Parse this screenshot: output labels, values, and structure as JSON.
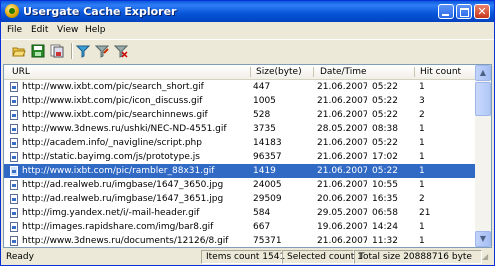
{
  "window": {
    "title": "Usergate Cache Explorer"
  },
  "menu": [
    "File",
    "Edit",
    "View",
    "Help"
  ],
  "toolbar": {
    "icons": [
      "open-folder-icon",
      "save-icon",
      "save-all-icon",
      "filter-icon",
      "filter-edit-icon",
      "filter-clear-icon"
    ]
  },
  "columns": [
    "URL",
    "Size(byte)",
    "Date/Time",
    "Hit count"
  ],
  "rows": [
    {
      "url": "http://www.ixbt.com/pic/search_short.gif",
      "size": "447",
      "date": "21.06.2007",
      "time": "05:22",
      "hits": "1"
    },
    {
      "url": "http://www.ixbt.com/pic/icon_discuss.gif",
      "size": "1005",
      "date": "21.06.2007",
      "time": "05:22",
      "hits": "3"
    },
    {
      "url": "http://www.ixbt.com/pic/searchinnews.gif",
      "size": "528",
      "date": "21.06.2007",
      "time": "05:22",
      "hits": "2"
    },
    {
      "url": "http://www.3dnews.ru/ushki/NEC-ND-4551.gif",
      "size": "3735",
      "date": "28.05.2007",
      "time": "08:38",
      "hits": "1"
    },
    {
      "url": "http://academ.info/_navigline/script.php",
      "size": "14183",
      "date": "21.06.2007",
      "time": "05:22",
      "hits": "1"
    },
    {
      "url": "http://static.bayimg.com/js/prototype.js",
      "size": "96357",
      "date": "21.06.2007",
      "time": "17:02",
      "hits": "1"
    },
    {
      "url": "http://www.ixbt.com/pic/rambler_88x31.gif",
      "size": "1419",
      "date": "21.06.2007",
      "time": "05:22",
      "hits": "1",
      "selected": true
    },
    {
      "url": "http://ad.realweb.ru/imgbase/1647_3650.jpg",
      "size": "24005",
      "date": "21.06.2007",
      "time": "10:55",
      "hits": "1"
    },
    {
      "url": "http://ad.realweb.ru/imgbase/1647_3651.jpg",
      "size": "29509",
      "date": "20.06.2007",
      "time": "16:35",
      "hits": "2"
    },
    {
      "url": "http://img.yandex.net/i/-mail-header.gif",
      "size": "584",
      "date": "29.05.2007",
      "time": "06:58",
      "hits": "21"
    },
    {
      "url": "http://images.rapidshare.com/img/bar8.gif",
      "size": "667",
      "date": "19.06.2007",
      "time": "14:24",
      "hits": "1"
    },
    {
      "url": "http://www.3dnews.ru/documents/12126/8.gif",
      "size": "75371",
      "date": "21.06.2007",
      "time": "11:32",
      "hits": "1"
    }
  ],
  "status": {
    "state": "Ready",
    "items": "Items count 1541",
    "selected": "Selected count 1",
    "total": "Total size 20888716 byte"
  }
}
